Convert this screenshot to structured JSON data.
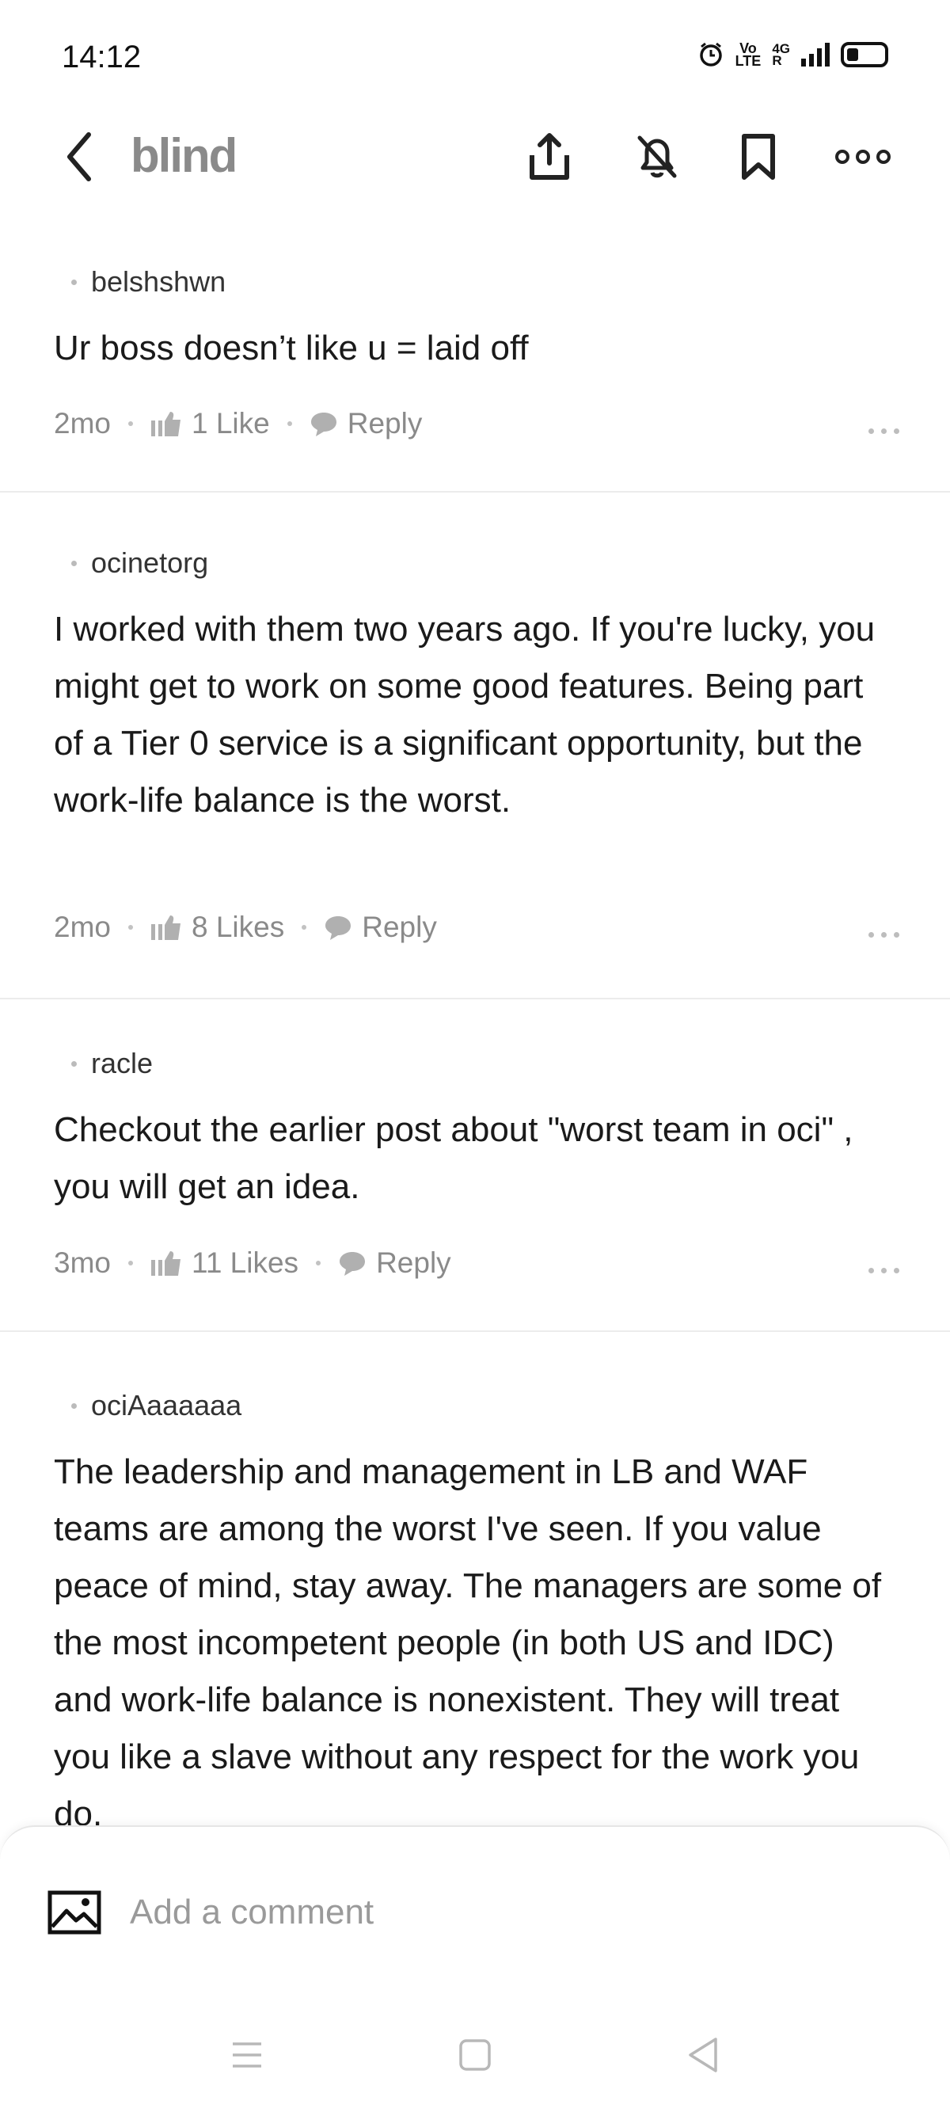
{
  "status_bar": {
    "time": "14:12",
    "volte_top": "Vo",
    "volte_bottom": "LTE",
    "network": "4G",
    "network_sub": "R",
    "icons": [
      "alarm-icon",
      "volte-icon",
      "signal-icon",
      "battery-icon"
    ]
  },
  "header": {
    "brand": "blind",
    "icons": [
      "back-icon",
      "share-icon",
      "notifications-off-icon",
      "bookmark-icon",
      "more-icon"
    ]
  },
  "comments": [
    {
      "author": "belshshwn",
      "text": "Ur boss doesn’t like u = laid off",
      "age": "2mo",
      "likes": "1 Like",
      "reply": "Reply"
    },
    {
      "author": "ocinetorg",
      "text": "I worked with them two years ago. If you're lucky, you might get to work on some good features. Being part of a Tier 0 service is a significant opportunity, but the work-life balance is the worst.",
      "age": "2mo",
      "likes": "8 Likes",
      "reply": "Reply"
    },
    {
      "author": "racle",
      "text": "Checkout the earlier post about \"worst team in oci\" , you will get an idea.",
      "age": "3mo",
      "likes": "11 Likes",
      "reply": "Reply"
    },
    {
      "author": "ociAaaaaaa",
      "text": "The leadership and management in LB and WAF teams are among the worst I've seen. If you value peace of mind, stay away. The managers are some of the most incompetent people (in both US and IDC) and work-life balance is nonexistent.  They will treat you like a slave without any respect for the work you do."
    }
  ],
  "comment_bar": {
    "placeholder": "Add a comment"
  },
  "nav_bar": {
    "icons": [
      "menu-icon",
      "home-icon",
      "back-nav-icon"
    ]
  },
  "colors": {
    "brand_gray": "#8a8a8a",
    "meta_gray": "#8a8a8a",
    "divider": "#ececec"
  }
}
